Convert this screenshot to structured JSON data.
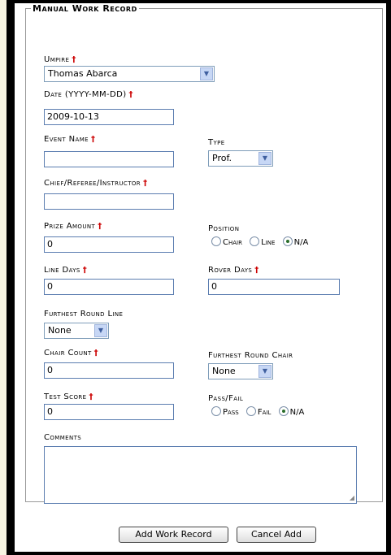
{
  "form": {
    "legend": "Manual Work Record",
    "required_mark": "†",
    "umpire": {
      "label": "Umpire",
      "value": "Thomas Abarca"
    },
    "date": {
      "label": "Date (YYYY-MM-DD)",
      "value": "2009-10-13"
    },
    "event_name": {
      "label": "Event Name",
      "value": ""
    },
    "type": {
      "label": "Type",
      "value": "Prof."
    },
    "chief": {
      "label": "Chief/Referee/Instructor",
      "value": ""
    },
    "prize_amount": {
      "label": "Prize Amount",
      "value": "0"
    },
    "position": {
      "label": "Position",
      "options": [
        "Chair",
        "Line",
        "N/A"
      ],
      "selected": "N/A"
    },
    "line_days": {
      "label": "Line Days",
      "value": "0"
    },
    "rover_days": {
      "label": "Rover Days",
      "value": "0"
    },
    "furthest_round_line": {
      "label": "Furthest Round Line",
      "value": "None"
    },
    "chair_count": {
      "label": "Chair Count",
      "value": "0"
    },
    "furthest_round_chair": {
      "label": "Furthest Round Chair",
      "value": "None"
    },
    "test_score": {
      "label": "Test Score",
      "value": "0"
    },
    "pass_fail": {
      "label": "Pass/Fail",
      "options": [
        "Pass",
        "Fail",
        "N/A"
      ],
      "selected": "N/A"
    },
    "comments": {
      "label": "Comments",
      "value": ""
    }
  },
  "buttons": {
    "add": "Add Work Record",
    "cancel": "Cancel Add"
  },
  "colors": {
    "background": "#f8f5e3",
    "frame": "#000000",
    "required": "#cc0000",
    "input_border": "#5b7db0"
  },
  "icons": {
    "dropdown": "chevron-down-icon",
    "radio": "radio-icon",
    "resize": "resize-grip-icon"
  }
}
